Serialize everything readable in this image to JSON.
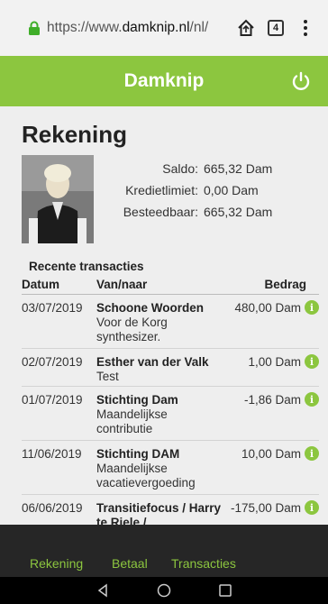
{
  "browser": {
    "url_prefix": "https://www.",
    "url_domain": "damknip.nl",
    "url_path": "/nl/",
    "tab_count": "4"
  },
  "app": {
    "title": "Damknip"
  },
  "account": {
    "page_title": "Rekening",
    "saldo_label": "Saldo:",
    "saldo_value": "665,32 Dam",
    "krediet_label": "Kredietlimiet:",
    "krediet_value": "0,00 Dam",
    "besteed_label": "Besteedbaar:",
    "besteed_value": "665,32 Dam"
  },
  "transactions": {
    "section_title": "Recente transacties",
    "columns": {
      "date": "Datum",
      "party": "Van/naar",
      "amount": "Bedrag"
    },
    "rows": [
      {
        "date": "03/07/2019",
        "name": "Schoone Woorden",
        "desc": "Voor de Korg synthesizer.",
        "amount": "480,00 Dam"
      },
      {
        "date": "02/07/2019",
        "name": "Esther van der Valk",
        "desc": "Test",
        "amount": "1,00 Dam"
      },
      {
        "date": "01/07/2019",
        "name": "Stichting Dam",
        "desc": "Maandelijkse contributie",
        "amount": "-1,86 Dam"
      },
      {
        "date": "11/06/2019",
        "name": "Stichting DAM",
        "desc": "Maandelijkse vacatievergoeding",
        "amount": "10,00 Dam"
      },
      {
        "date": "06/06/2019",
        "name": "Transitiefocus / Harry te Riele /",
        "desc": "",
        "amount": "-175,00 Dam"
      }
    ]
  },
  "bottom_nav": {
    "rekening": "Rekening",
    "betaal": "Betaal",
    "transacties": "Transacties"
  },
  "colors": {
    "brand_green": "#8cc63f",
    "nav_dark": "#262626"
  },
  "icons": [
    "lock-icon",
    "home-icon",
    "tabs-icon",
    "more-icon",
    "power-icon",
    "info-icon",
    "back-icon",
    "home-circle-icon",
    "recents-icon"
  ]
}
